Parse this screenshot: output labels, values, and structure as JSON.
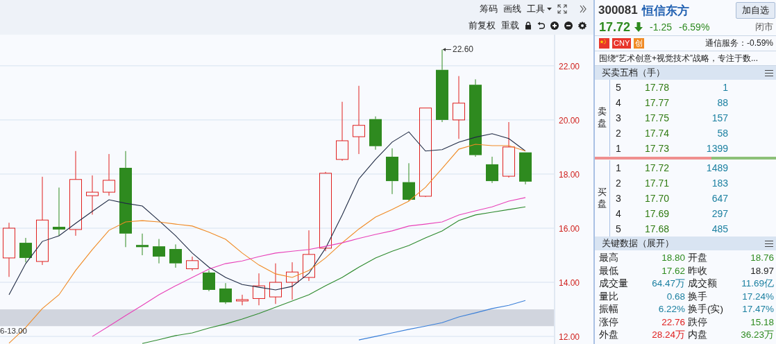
{
  "toolbar": {
    "row1": [
      {
        "label": "筹码",
        "dropdown": false
      },
      {
        "label": "画线",
        "dropdown": false
      },
      {
        "label": "工具",
        "dropdown": true
      }
    ],
    "row2": [
      {
        "label": "前复权"
      },
      {
        "label": "重载"
      }
    ]
  },
  "chart": {
    "chart_data": {
      "type": "line",
      "ylim": [
        11.72,
        23.15
      ],
      "grid": true,
      "bands": [
        {
          "axis": "y",
          "from": 12.38,
          "to": 13.0
        }
      ],
      "yticks": [
        {
          "value": 12,
          "label": "12.00"
        },
        {
          "value": 14,
          "label": "14.00"
        },
        {
          "value": 16,
          "label": "16.00"
        },
        {
          "value": 18,
          "label": "18.00"
        },
        {
          "value": 20,
          "label": "20.00"
        },
        {
          "value": 22,
          "label": "22.00"
        }
      ],
      "series": [
        {
          "color": "#1f2a44",
          "values": [
            13.54,
            14.69,
            15.51,
            15.72,
            16.18,
            16.62,
            17.05,
            16.92,
            16.82,
            16.28,
            15.72,
            15.08,
            14.56,
            14.18,
            13.92,
            13.82,
            13.72,
            13.85,
            14.33,
            15.26,
            16.49,
            17.82,
            18.54,
            19.18,
            19.56,
            18.85,
            18.9,
            19.18,
            19.36,
            19.49,
            19.31,
            18.85
          ]
        },
        {
          "color": "#f08a24",
          "values": [
            11.75,
            12.33,
            13.03,
            13.54,
            14.44,
            15.21,
            15.92,
            16.23,
            16.28,
            16.23,
            16.15,
            16.08,
            15.85,
            15.59,
            15.08,
            14.64,
            14.31,
            14.18,
            14.44,
            14.9,
            15.46,
            15.97,
            16.41,
            16.69,
            17.0,
            17.51,
            18.21,
            18.92,
            19.1,
            19.05,
            19.05,
            18.85
          ]
        },
        {
          "color": "#e840b8",
          "values": [
            null,
            null,
            null,
            null,
            null,
            12.0,
            12.38,
            12.77,
            13.15,
            13.54,
            13.87,
            14.18,
            14.49,
            14.69,
            14.79,
            14.95,
            15.08,
            15.15,
            15.21,
            15.33,
            15.46,
            15.62,
            15.77,
            15.9,
            16.08,
            16.15,
            16.23,
            16.49,
            16.64,
            16.79,
            17.0,
            17.13
          ]
        },
        {
          "color": "#2d8a2d",
          "values": [
            null,
            null,
            null,
            null,
            null,
            null,
            null,
            null,
            11.74,
            11.88,
            12.03,
            12.13,
            12.31,
            12.46,
            12.64,
            12.85,
            13.08,
            13.31,
            13.54,
            13.87,
            14.18,
            14.56,
            14.9,
            15.15,
            15.36,
            15.64,
            15.9,
            16.28,
            16.49,
            16.59,
            16.69,
            16.79
          ]
        },
        {
          "color": "#3a7fd8",
          "values": [
            null,
            null,
            null,
            null,
            null,
            null,
            null,
            null,
            null,
            null,
            null,
            null,
            null,
            null,
            null,
            null,
            null,
            null,
            null,
            null,
            null,
            11.87,
            12.0,
            12.13,
            12.26,
            12.38,
            12.51,
            12.72,
            12.87,
            13.03,
            13.15,
            13.33
          ]
        }
      ],
      "annotations": [
        "22.60",
        "6-13.00"
      ]
    }
  },
  "stock": {
    "code": "300081",
    "name": "恒信东方",
    "watch_button": "加自选",
    "price": "17.72",
    "falling": true,
    "change": "-1.25",
    "change_pct": "-6.59%",
    "market_status": "闭市",
    "badges": [
      {
        "kind": "flag"
      },
      {
        "kind": "text",
        "label": "CNY",
        "color": "#e8352b"
      },
      {
        "kind": "text",
        "label": "创",
        "color": "#f08a24"
      }
    ],
    "sector": "通信服务：-0.59%",
    "description": "围绕“艺术创意+视觉技术”战略，专注于数..."
  },
  "order_book": {
    "title": "买卖五档（手）",
    "sell_label": "卖盘",
    "buy_label": "买盘",
    "sell": [
      {
        "level": "5",
        "price": "17.78",
        "volume": "1"
      },
      {
        "level": "4",
        "price": "17.77",
        "volume": "88"
      },
      {
        "level": "3",
        "price": "17.75",
        "volume": "157"
      },
      {
        "level": "2",
        "price": "17.74",
        "volume": "58"
      },
      {
        "level": "1",
        "price": "17.73",
        "volume": "1399"
      }
    ],
    "ratio_bar": {
      "level": 0.64
    },
    "buy": [
      {
        "level": "1",
        "price": "17.72",
        "volume": "1489"
      },
      {
        "level": "2",
        "price": "17.71",
        "volume": "183"
      },
      {
        "level": "3",
        "price": "17.70",
        "volume": "647"
      },
      {
        "level": "4",
        "price": "17.69",
        "volume": "297"
      },
      {
        "level": "5",
        "price": "17.68",
        "volume": "485"
      }
    ]
  },
  "key_data": {
    "title": "关键数据（展开）",
    "rows": [
      [
        {
          "label": "最高",
          "value": "18.80",
          "color": "#2e8b1f"
        },
        {
          "label": "开盘",
          "value": "18.76",
          "color": "#2e8b1f"
        }
      ],
      [
        {
          "label": "最低",
          "value": "17.62",
          "color": "#2e8b1f"
        },
        {
          "label": "昨收",
          "value": "18.97",
          "color": "#222222"
        }
      ],
      [
        {
          "label": "成交量",
          "value": "64.47万",
          "color": "#1a7fa0"
        },
        {
          "label": "成交额",
          "value": "11.69亿",
          "color": "#1a7fa0"
        }
      ],
      [
        {
          "label": "量比",
          "value": "0.68",
          "color": "#1a7fa0"
        },
        {
          "label": "换手",
          "value": "17.24%",
          "color": "#1a7fa0"
        }
      ],
      [
        {
          "label": "振幅",
          "value": "6.22%",
          "color": "#1a7fa0"
        },
        {
          "label": "换手(实)",
          "value": "17.47%",
          "color": "#1a7fa0"
        }
      ],
      [
        {
          "label": "涨停",
          "value": "22.76",
          "color": "#e0201f"
        },
        {
          "label": "跌停",
          "value": "15.18",
          "color": "#2e8b1f"
        }
      ],
      [
        {
          "label": "外盘",
          "value": "28.24万",
          "color": "#e0201f"
        },
        {
          "label": "内盘",
          "value": "36.23万",
          "color": "#2e8b1f"
        }
      ]
    ]
  }
}
